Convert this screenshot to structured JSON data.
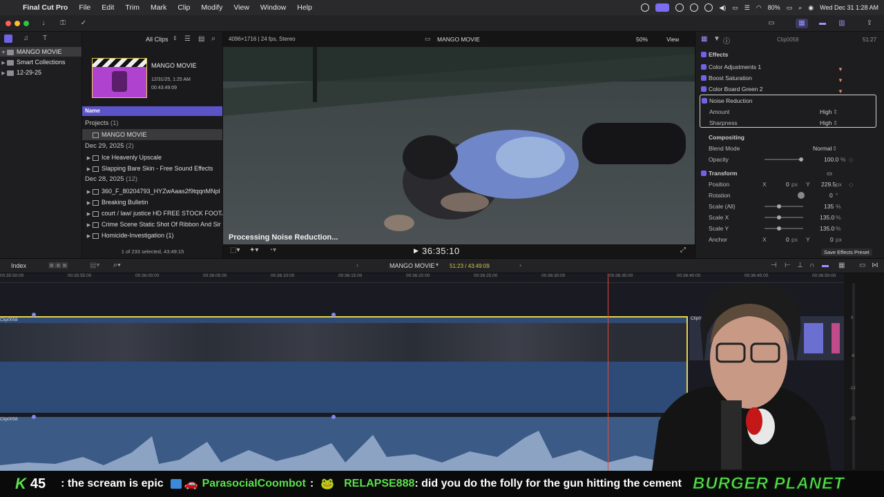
{
  "menubar": {
    "app_name": "Final Cut Pro",
    "items": [
      "File",
      "Edit",
      "Trim",
      "Mark",
      "Clip",
      "Modify",
      "View",
      "Window",
      "Help"
    ],
    "battery": "80%",
    "datetime": "Wed Dec 31  1:28 AM"
  },
  "browser": {
    "filter_label": "All Clips",
    "library_name": "MANGO MOVIE",
    "sidebar": [
      {
        "label": "MANGO MOVIE",
        "selected": true
      },
      {
        "label": "Smart Collections",
        "selected": false
      },
      {
        "label": "12-29-25",
        "selected": false
      }
    ],
    "preview": {
      "title": "MANGO MOVIE",
      "date": "12/31/25, 1:25 AM",
      "duration": "00:43:49:09"
    },
    "column_header": "Name",
    "groups": [
      {
        "label": "Projects",
        "count": "(1)",
        "items": [
          "MANGO MOVIE"
        ]
      },
      {
        "label": "Dec 29, 2025",
        "count": "(2)",
        "items": [
          "Ice Heavenly Upscale",
          "Slapping Bare Skin - Free Sound Effects"
        ]
      },
      {
        "label": "Dec 28, 2025",
        "count": "(12)",
        "items": [
          "360_F_80204793_HYZwAaas2f9tqqnMNpl",
          "Breaking Bulletin",
          "court / law/ justice HD FREE STOCK FOOTA",
          "Crime Scene Static Shot Of Ribbon And Sir",
          "Homicide-Investigation (1)"
        ]
      }
    ],
    "selection_status": "1 of 233 selected, 43:49:15"
  },
  "viewer": {
    "format": "4096×1716 | 24 fps, Stereo",
    "title": "MANGO MOVIE",
    "zoom": "50%",
    "view_label": "View",
    "processing_text": "Processing Noise Reduction...",
    "timecode": "36:35:10"
  },
  "inspector": {
    "clip_name": "Clip0058",
    "clip_duration": "51:27",
    "effects_header": "Effects",
    "effects": [
      "Color Adjustments 1",
      "Boost Saturation",
      "Color Board Green 2",
      "Noise Reduction"
    ],
    "noise_reduction": {
      "amount_label": "Amount",
      "amount_value": "High",
      "sharpness_label": "Sharpness",
      "sharpness_value": "High"
    },
    "compositing": {
      "header": "Compositing",
      "blend_label": "Blend Mode",
      "blend_value": "Normal",
      "opacity_label": "Opacity",
      "opacity_value": "100.0",
      "opacity_unit": "%"
    },
    "transform": {
      "header": "Transform",
      "position_label": "Position",
      "pos_x_label": "X",
      "pos_x": "0",
      "pos_y_label": "Y",
      "pos_y": "229.5",
      "px": "px",
      "rotation_label": "Rotation",
      "rotation_value": "0",
      "rotation_unit": "°",
      "scale_all_label": "Scale (All)",
      "scale_all_value": "135",
      "pct": "%",
      "scale_x_label": "Scale X",
      "scale_x_value": "135.0",
      "scale_y_label": "Scale Y",
      "scale_y_value": "135.0",
      "anchor_label": "Anchor",
      "anchor_x_label": "X",
      "anchor_x": "0",
      "anchor_y_label": "Y",
      "anchor_y": "0"
    },
    "save_preset": "Save Effects Preset"
  },
  "timeline": {
    "index_label": "Index",
    "project_name": "MANGO MOVIE",
    "duration_display": "51:23 / 43:49:09",
    "ruler": [
      "00:35:50:00",
      "00:35:55:00",
      "00:36:00:00",
      "00:36:05:00",
      "00:36:10:00",
      "00:36:15:00",
      "00:36:20:00",
      "00:36:25:00",
      "00:36:30:00",
      "00:36:35:00",
      "00:36:40:00",
      "00:36:45:00",
      "00:36:50:00"
    ],
    "clip_label": "Clip0058",
    "next_clip_label": "Clip0031",
    "audio_clip_label": "Clip0058",
    "meter_labels": [
      "0",
      "-6",
      "-12",
      "-20"
    ]
  },
  "chat": {
    "badge": "K",
    "count": "45",
    "line1": ": the scream is epic",
    "user2": "ParasocialCoombot",
    "sep2": ":",
    "user3": "RELAPSE888",
    "msg3": ": did you do the folly for the gun hitting the cement",
    "brand": "BURGER PLANET"
  },
  "colors": {
    "accent": "#6f64e8",
    "clip_border": "#e8d24a",
    "playhead": "#e04a3a",
    "chat_green": "#5be04d"
  }
}
